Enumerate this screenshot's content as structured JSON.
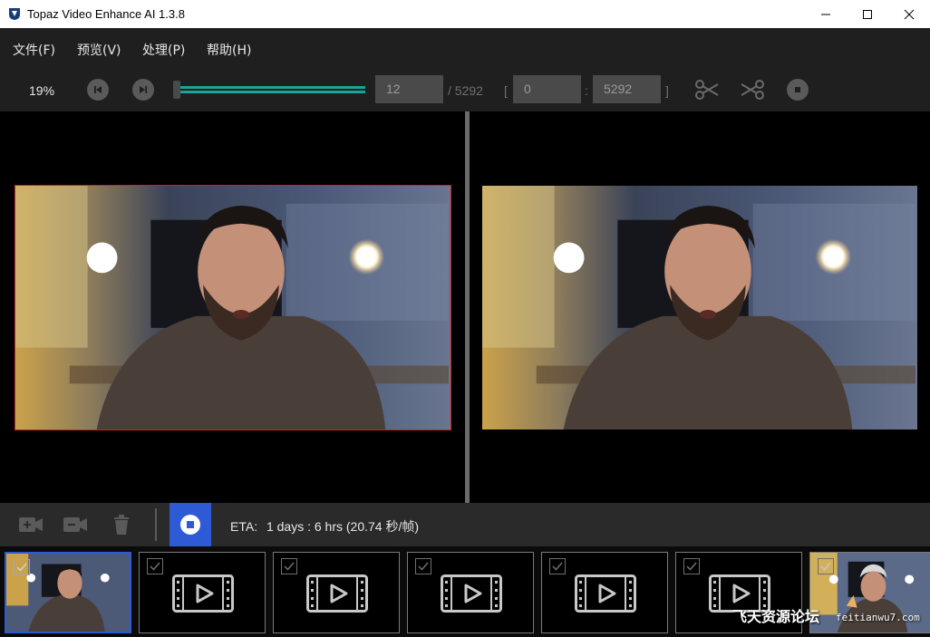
{
  "window": {
    "title": "Topaz Video Enhance AI 1.3.8",
    "controls": [
      "minimize-icon",
      "maximize-icon",
      "close-icon"
    ]
  },
  "menu": {
    "items": [
      {
        "label": "文件(F)"
      },
      {
        "label": "预览(V)"
      },
      {
        "label": "处理(P)"
      },
      {
        "label": "帮助(H)"
      }
    ]
  },
  "toolbar": {
    "zoom": "19%",
    "progress": 1.0,
    "current_frame": "12",
    "total_frames": "/ 5292",
    "range_open": "[",
    "range_start": "0",
    "range_sep": ":",
    "range_end": "5292",
    "range_close": "]",
    "icons": [
      "skip-back-icon",
      "play-pause-icon",
      "cut-icon",
      "cut-range-icon",
      "stop-icon"
    ]
  },
  "status": {
    "eta_label": "ETA:",
    "eta_value": "1 days : 6 hrs  (20.74 秒/帧)"
  },
  "actions": {
    "icons": [
      "add-video-icon",
      "remove-video-icon",
      "delete-icon",
      "stop-process-icon"
    ]
  },
  "queue": {
    "items": [
      {
        "type": "thumbnail",
        "checked": true,
        "active": true
      },
      {
        "type": "placeholder",
        "checked": true
      },
      {
        "type": "placeholder",
        "checked": true
      },
      {
        "type": "placeholder",
        "checked": true
      },
      {
        "type": "placeholder",
        "checked": true
      },
      {
        "type": "placeholder",
        "checked": true
      },
      {
        "type": "thumbnail",
        "checked": true
      }
    ]
  },
  "watermark": {
    "text": "飞天资源论坛",
    "site": "feitianwu7.com"
  },
  "colors": {
    "accent": "#2e5ad6",
    "progress": "#1aa39a",
    "selection_border": "#cc2222"
  }
}
